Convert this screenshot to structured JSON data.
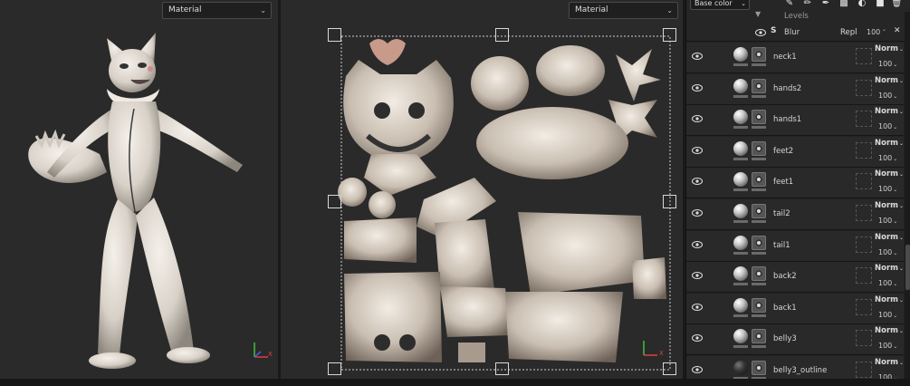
{
  "viewport3d": {
    "material_select": "Material"
  },
  "viewport2d": {
    "material_select": "Material"
  },
  "axis": {
    "x": "X",
    "y": "Y",
    "z": "Z"
  },
  "layers_panel": {
    "channel_select": "Base color",
    "top_rows": [
      {
        "name": "Levels"
      },
      {
        "name": "Blur",
        "blend": "Repl",
        "opacity": "100"
      }
    ],
    "layers": [
      {
        "name": "neck1",
        "blend": "Norm",
        "opacity": "100"
      },
      {
        "name": "hands2",
        "blend": "Norm",
        "opacity": "100"
      },
      {
        "name": "hands1",
        "blend": "Norm",
        "opacity": "100"
      },
      {
        "name": "feet2",
        "blend": "Norm",
        "opacity": "100"
      },
      {
        "name": "feet1",
        "blend": "Norm",
        "opacity": "100"
      },
      {
        "name": "tail2",
        "blend": "Norm",
        "opacity": "100"
      },
      {
        "name": "tail1",
        "blend": "Norm",
        "opacity": "100"
      },
      {
        "name": "back2",
        "blend": "Norm",
        "opacity": "100"
      },
      {
        "name": "back1",
        "blend": "Norm",
        "opacity": "100"
      },
      {
        "name": "belly3",
        "blend": "Norm",
        "opacity": "100"
      },
      {
        "name": "belly3_outline",
        "blend": "Norm",
        "opacity": "100"
      }
    ]
  },
  "colors": {
    "viewport_bg": "#2a2a2a",
    "panel_bg": "#232323",
    "model_fur": "#e6e0d8",
    "uv_bg": "#2e2e2e",
    "x_axis": "#e04040",
    "y_axis": "#40c040",
    "z_axis": "#4060e0"
  }
}
